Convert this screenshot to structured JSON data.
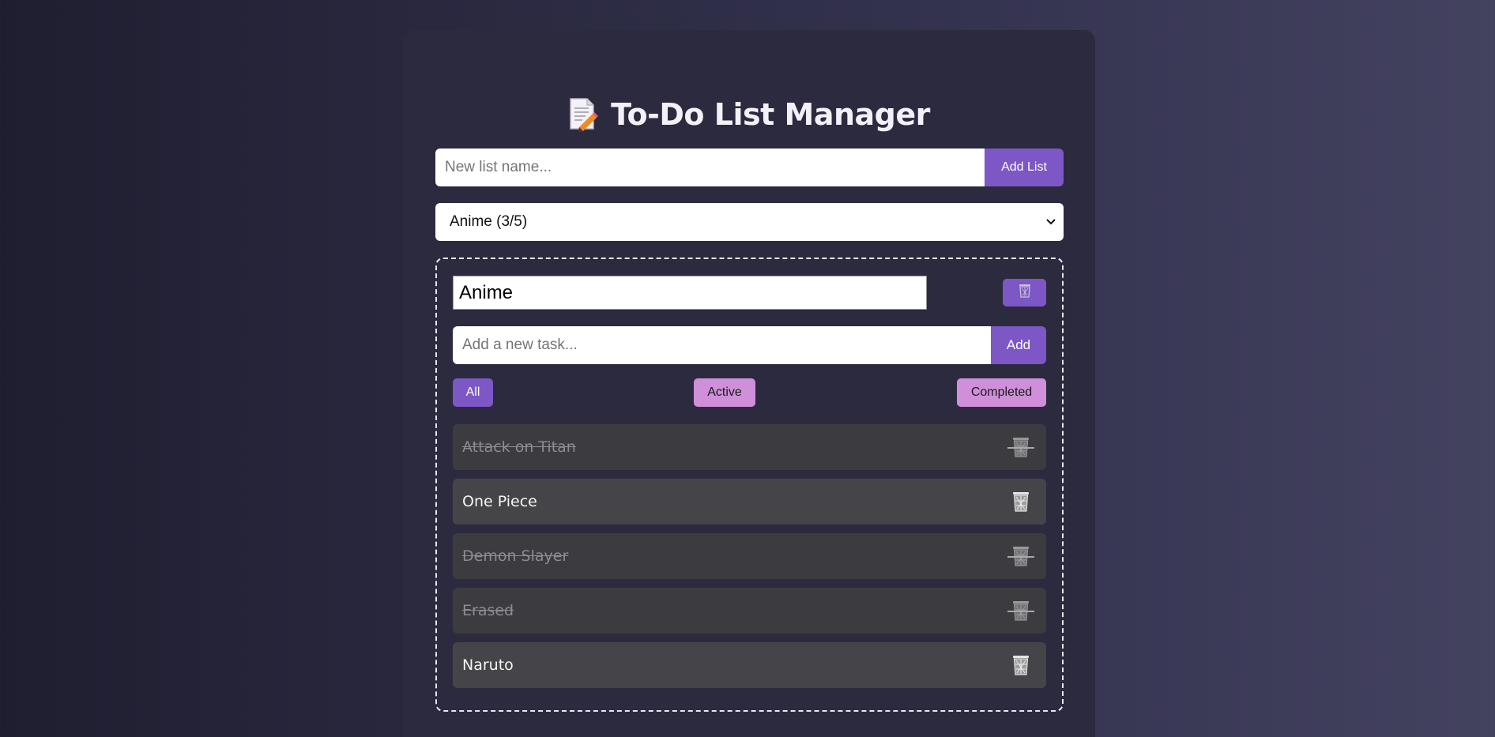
{
  "app": {
    "title": "To-Do List Manager"
  },
  "new_list": {
    "placeholder": "New list name...",
    "value": "",
    "button_label": "Add List"
  },
  "list_selector": {
    "selected": "Anime (3/5)",
    "options": [
      "Anime (3/5)"
    ]
  },
  "current_list": {
    "name": "Anime",
    "delete_icon": "trash-icon",
    "new_task_placeholder": "Add a new task...",
    "add_button_label": "Add",
    "filters": [
      {
        "label": "All",
        "active": true
      },
      {
        "label": "Active",
        "active": false
      },
      {
        "label": "Completed",
        "active": false
      }
    ],
    "tasks": [
      {
        "text": "Attack on Titan",
        "completed": true
      },
      {
        "text": "One Piece",
        "completed": false
      },
      {
        "text": "Demon Slayer",
        "completed": true
      },
      {
        "text": "Erased",
        "completed": true
      },
      {
        "text": "Naruto",
        "completed": false
      }
    ]
  },
  "colors": {
    "accent": "#7c57c5",
    "filter_inactive": "#cf8fd9",
    "card_bg": "#2c2a3e"
  }
}
